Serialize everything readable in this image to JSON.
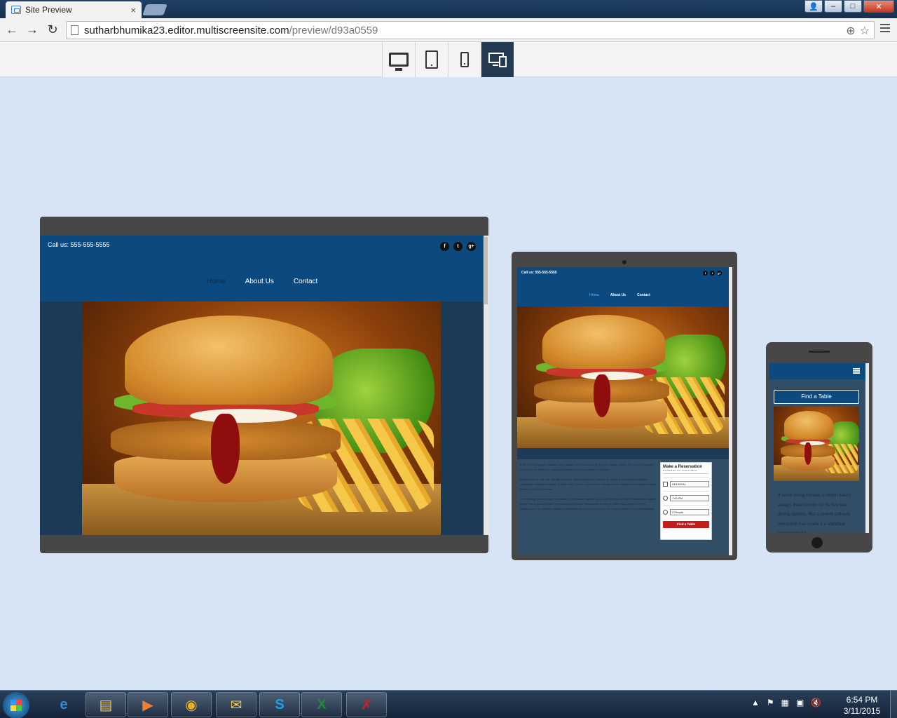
{
  "browser": {
    "tab_title": "Site Preview",
    "tab_close": "×",
    "url_host": "sutharbhumika23.editor.multiscreensite.com",
    "url_path": "/preview/d93a0559",
    "back": "←",
    "forward": "→",
    "reload": "↻",
    "zoom": "⊕",
    "star": "☆",
    "minimize": "–",
    "maximize": "□",
    "close": "✕",
    "user": "👤"
  },
  "preview_toolbar": {
    "devices": [
      {
        "name": "desktop",
        "icon": "desktop-icon",
        "active": false
      },
      {
        "name": "tablet",
        "icon": "tablet-icon",
        "active": false
      },
      {
        "name": "mobile",
        "icon": "phone-icon",
        "active": false
      },
      {
        "name": "all-devices",
        "icon": "multi-device-icon",
        "active": true
      }
    ]
  },
  "site": {
    "phone": "Call us: 555-555-5555",
    "nav": [
      "Home",
      "About Us",
      "Contact"
    ],
    "social": [
      "f",
      "t",
      "g+"
    ],
    "paragraphs": [
      "If we're being honest, London hasn't always been known for its five-star dining options. But a recent culinary revolution has made it a standout destination for gourmands everywhere.",
      "We've come up with the ultimate list of the best restaurant in London. To create it, we looked at notable restaurant rankings compiled by food critics, diners, and experts, and gave each restaurant a numerical rating based on our own formula.",
      "The rankings we used were the National Restaurant Awards 2014, The World's 100 Best Restaurants, Zagat's Best Food in London 2015, OpenTable's 2015 Best Restaurants in the UK, Time Out London's Top 50 Restaurants, The Michelin Guide Great Britain and Ireland 2014, and The Square Meal's 5-Star Restaurants..."
    ],
    "reservation": {
      "title": "Make a Reservation",
      "subtitle": "POWERED BY OPENTABLE",
      "date": "04/13/2011",
      "time": "7:00 PM",
      "party": "2 People",
      "button": "Find a Table"
    },
    "mobile_find": "Find a Table",
    "mobile_text": "If we're being honest, London hasn't always been known for its five-star dining options. But a recent culinary revolution has made it a standout destination for"
  },
  "taskbar": {
    "apps": [
      {
        "name": "internet-explorer",
        "glyph": "e",
        "color": "#2d8fe0"
      },
      {
        "name": "file-explorer",
        "glyph": "▤",
        "color": "#f0c860"
      },
      {
        "name": "media-player",
        "glyph": "▶",
        "color": "#f08030"
      },
      {
        "name": "chrome",
        "glyph": "◉",
        "color": "#e8b020"
      },
      {
        "name": "outlook",
        "glyph": "✉",
        "color": "#f5c542"
      },
      {
        "name": "skype",
        "glyph": "S",
        "color": "#1aa3e8"
      },
      {
        "name": "excel",
        "glyph": "X",
        "color": "#1f8a3a"
      },
      {
        "name": "paint-app",
        "glyph": "✗",
        "color": "#d02020"
      }
    ],
    "tray_icons": [
      "▲",
      "⚑",
      "▦",
      "▣",
      "🔇"
    ],
    "time": "6:54 PM",
    "date": "3/11/2015"
  }
}
